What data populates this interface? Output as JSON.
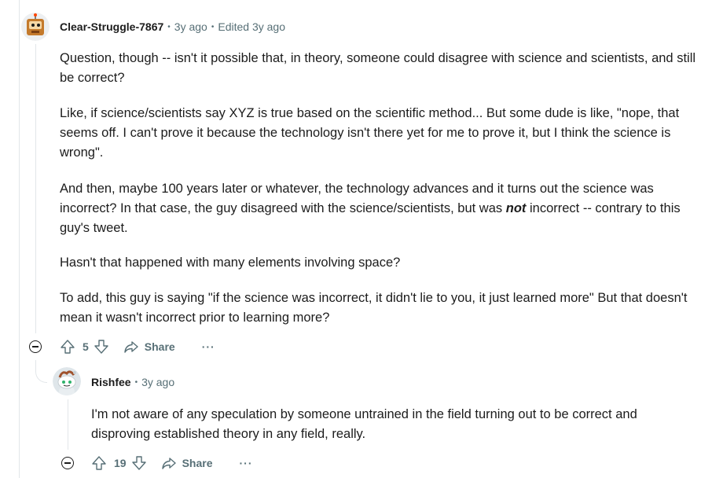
{
  "comments": [
    {
      "author": "Clear-Struggle-7867",
      "age": "3y ago",
      "edited": "Edited 3y ago",
      "paragraphs": [
        "Question, though -- isn't it possible that, in theory, someone could disagree with science and scientists, and still be correct?",
        "Like, if science/scientists say XYZ is true based on the scientific method... But some dude is like, \"nope, that seems off. I can't prove it because the technology isn't there yet for me to prove it, but I think the science is wrong\".",
        "And then, maybe 100 years later or whatever, the technology advances and it turns out the science was incorrect? In that case, the guy disagreed with the science/scientists, but was",
        "not",
        " incorrect -- contrary to this guy's tweet.",
        "Hasn't that happened with many elements involving space?",
        "To add, this guy is saying \"if the science was incorrect, it didn't lie to you, it just learned more\" But that doesn't mean it wasn't incorrect prior to learning more?"
      ],
      "votes": "5",
      "share_label": "Share",
      "more_label": "···"
    },
    {
      "author": "Rishfee",
      "age": "3y ago",
      "paragraphs": [
        "I'm not aware of any speculation by someone untrained in the field turning out to be correct and disproving established theory in any field, really."
      ],
      "votes": "19",
      "share_label": "Share",
      "more_label": "···"
    }
  ],
  "separator": "•",
  "colors": {
    "text": "#1c1c1c",
    "meta": "#576f76",
    "thread": "#e2e6e9"
  },
  "icons": [
    "robot-avatar-icon",
    "snoo-avatar-icon",
    "upvote-icon",
    "downvote-icon",
    "share-icon",
    "collapse-icon",
    "more-icon"
  ]
}
